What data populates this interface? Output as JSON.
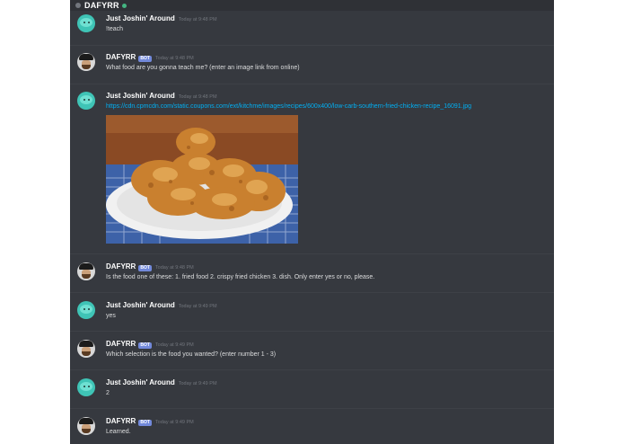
{
  "server": {
    "name": "DAFYRR"
  },
  "messages": [
    {
      "author": "Just Joshin' Around",
      "bot": false,
      "timestamp": "Today at 9:48 PM",
      "text": "!teach",
      "avatar": "joshin-avatar"
    },
    {
      "author": "DAFYRR",
      "bot": true,
      "badge": "BOT",
      "timestamp": "Today at 9:48 PM",
      "text": "What food are you gonna teach me? (enter an image link from online)",
      "avatar": "dafyrr-avatar"
    },
    {
      "author": "Just Joshin' Around",
      "bot": false,
      "timestamp": "Today at 9:48 PM",
      "text": "https://cdn.cpmcdn.com/static.coupons.com/ext/kitchme/images/recipes/600x400/low-carb-southern-fried-chicken-recipe_16091.jpg",
      "avatar": "joshin-avatar",
      "image": "fried-chicken-photo"
    },
    {
      "author": "DAFYRR",
      "bot": true,
      "badge": "BOT",
      "timestamp": "Today at 9:48 PM",
      "text": "Is the food one of these: 1. fried food 2. crispy fried chicken 3. dish. Only enter yes or no, please.",
      "avatar": "dafyrr-avatar"
    },
    {
      "author": "Just Joshin' Around",
      "bot": false,
      "timestamp": "Today at 9:49 PM",
      "text": "yes",
      "avatar": "joshin-avatar"
    },
    {
      "author": "DAFYRR",
      "bot": true,
      "badge": "BOT",
      "timestamp": "Today at 9:49 PM",
      "text": "Which selection is the food you wanted? (enter number 1 - 3)",
      "avatar": "dafyrr-avatar"
    },
    {
      "author": "Just Joshin' Around",
      "bot": false,
      "timestamp": "Today at 9:49 PM",
      "text": "2",
      "avatar": "joshin-avatar"
    },
    {
      "author": "DAFYRR",
      "bot": true,
      "badge": "BOT",
      "timestamp": "Today at 9:49 PM",
      "text": "Learned.",
      "avatar": "dafyrr-avatar"
    }
  ],
  "colors": {
    "background": "#36393f",
    "header": "#2f3136",
    "link": "#00b0f4",
    "bot_badge": "#7289da",
    "online": "#43b581"
  }
}
